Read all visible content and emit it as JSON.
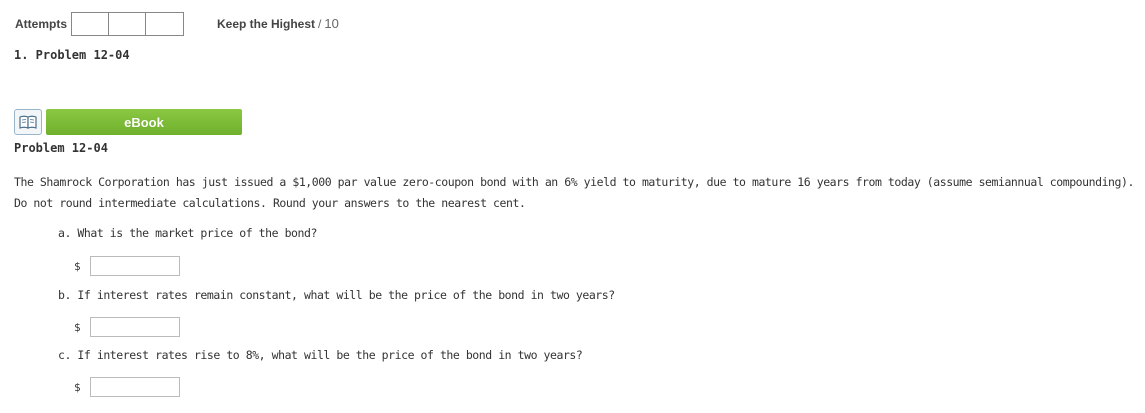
{
  "header": {
    "attempts_label": "Attempts",
    "attempt_boxes": 3,
    "keep_label": "Keep the Highest",
    "keep_separator": "/",
    "keep_max": "10"
  },
  "problem": {
    "heading": "1. Problem 12-04",
    "ebook_label": "eBook",
    "title": "Problem 12-04",
    "description": "The Shamrock Corporation has just issued a $1,000 par value zero-coupon bond with an 6% yield to maturity, due to mature 16 years from today (assume semiannual compounding). Do not round intermediate calculations. Round your answers to the nearest cent.",
    "questions": [
      {
        "text": "a. What is the market price of the bond?",
        "currency": "$",
        "value": ""
      },
      {
        "text": "b. If interest rates remain constant, what will be the price of the bond in two years?",
        "currency": "$",
        "value": ""
      },
      {
        "text": "c. If interest rates rise to 8%, what will be the price of the bond in two years?",
        "currency": "$",
        "value": ""
      }
    ]
  },
  "colors": {
    "ebook_green": "#7dbd37",
    "text": "#333333"
  },
  "icons": {
    "ebook": "book-icon"
  }
}
